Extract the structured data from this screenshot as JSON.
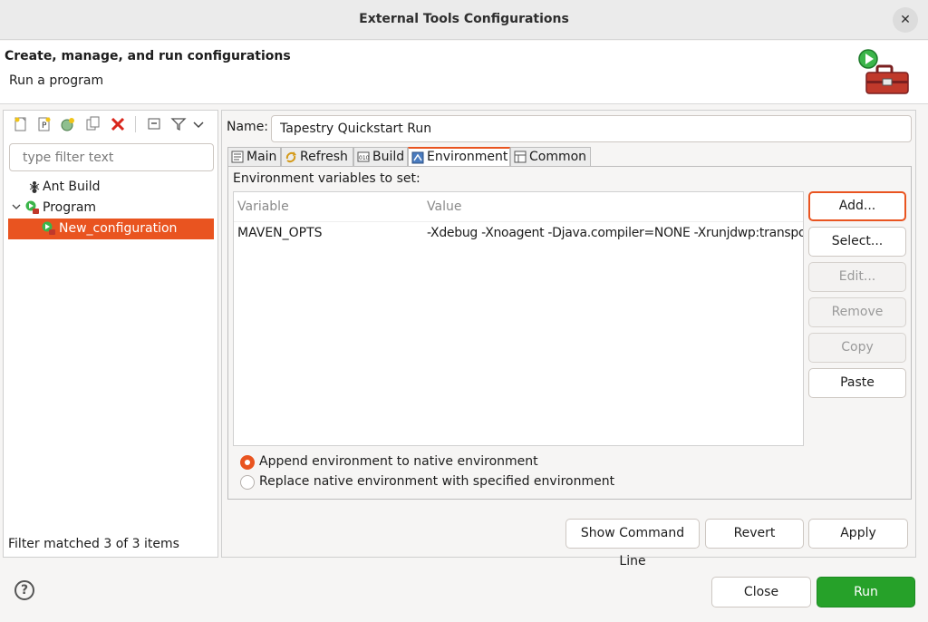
{
  "window": {
    "title": "External Tools Configurations"
  },
  "header": {
    "title": "Create, manage, and run configurations",
    "subtitle": "Run a program"
  },
  "left": {
    "toolbar_icons": [
      "new-launch-config-icon",
      "new-prototype-icon",
      "export-icon",
      "duplicate-icon",
      "delete-icon",
      "collapse-all-icon",
      "filter-icon",
      "chevron-down-icon"
    ],
    "filter_placeholder": "type filter text",
    "tree": [
      {
        "label": "Ant Build",
        "icon": "ant-icon"
      },
      {
        "label": "Program",
        "icon": "program-icon",
        "expanded": true
      },
      {
        "label": "New_configuration",
        "icon": "config-icon",
        "selected": true
      }
    ],
    "status": "Filter matched 3 of 3 items"
  },
  "right": {
    "name_label": "Name:",
    "name_value": "Tapestry Quickstart Run",
    "tabs": [
      {
        "label": "Main",
        "icon": "main-tab-icon"
      },
      {
        "label": "Refresh",
        "icon": "refresh-icon"
      },
      {
        "label": "Build",
        "icon": "build-icon"
      },
      {
        "label": "Environment",
        "icon": "environment-icon",
        "active": true
      },
      {
        "label": "Common",
        "icon": "common-icon"
      }
    ],
    "env_label": "Environment variables to set:",
    "table": {
      "headers": [
        "Variable",
        "Value"
      ],
      "rows": [
        {
          "variable": "MAVEN_OPTS",
          "value": "-Xdebug -Xnoagent -Djava.compiler=NONE -Xrunjdwp:transport=dt_socket"
        }
      ]
    },
    "side_buttons": [
      "Add...",
      "Select...",
      "Edit...",
      "Remove",
      "Copy",
      "Paste"
    ],
    "radios": [
      {
        "label": "Append environment to native environment",
        "checked": true
      },
      {
        "label": "Replace native environment with specified environment",
        "checked": false
      }
    ],
    "bottom_buttons": [
      "Show Command Line",
      "Revert",
      "Apply"
    ]
  },
  "dialog": {
    "help": "?",
    "close": "Close",
    "run": "Run"
  },
  "colors": {
    "accent": "#e95420",
    "run": "#26a129"
  }
}
